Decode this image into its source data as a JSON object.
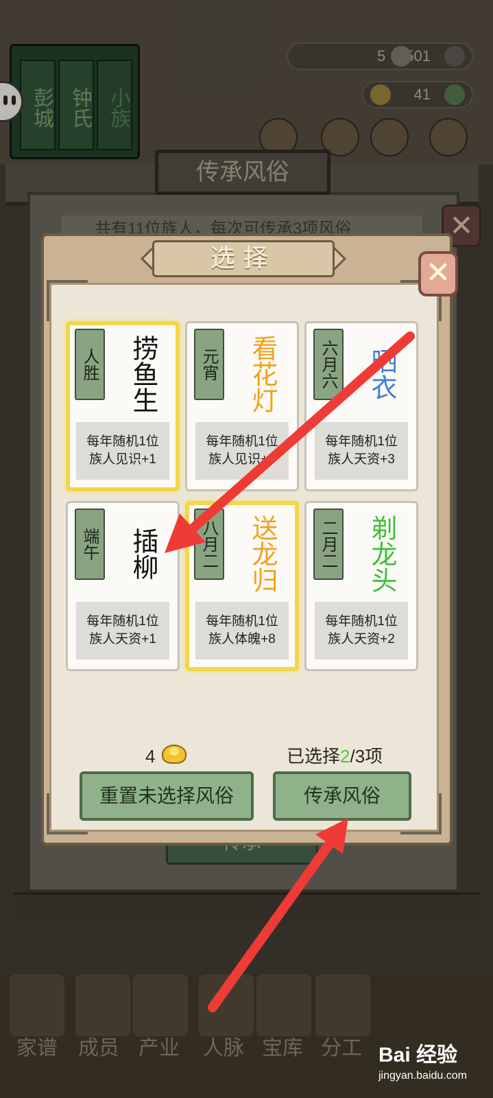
{
  "background": {
    "clan_names": [
      "彭城",
      "钟氏",
      "小族"
    ],
    "resources": [
      {
        "name": "tickets",
        "value": "5"
      },
      {
        "name": "coins",
        "value": "501"
      },
      {
        "name": "gold",
        "value": "41"
      }
    ],
    "panel_title": "传承风俗",
    "panel_text": "共有11位族人，每次可传承3项风俗",
    "panel_button": "传承",
    "nav": [
      "家谱",
      "成员",
      "产业",
      "人脉",
      "宝库",
      "分工"
    ]
  },
  "dialog": {
    "title": "选择",
    "close_icon": "close-icon",
    "cards": [
      {
        "festival": "人胜",
        "custom": "捞鱼生",
        "desc_line1": "每年随机1位",
        "desc_line2": "族人见识+1",
        "selected": true,
        "color": "#111111"
      },
      {
        "festival": "元宵",
        "custom": "看花灯",
        "desc_line1": "每年随机1位",
        "desc_line2": "族人见识+8",
        "selected": false,
        "color": "#f0a21c"
      },
      {
        "festival": "六月六",
        "custom": "晒衣",
        "desc_line1": "每年随机1位",
        "desc_line2": "族人天资+3",
        "selected": false,
        "color": "#3f7fd6"
      },
      {
        "festival": "端午",
        "custom": "插柳",
        "desc_line1": "每年随机1位",
        "desc_line2": "族人天资+1",
        "selected": false,
        "color": "#111111"
      },
      {
        "festival": "八月二",
        "custom": "送龙归",
        "desc_line1": "每年随机1位",
        "desc_line2": "族人体魄+8",
        "selected": true,
        "color": "#f0a21c"
      },
      {
        "festival": "二月二",
        "custom": "剃龙头",
        "desc_line1": "每年随机1位",
        "desc_line2": "族人天资+2",
        "selected": false,
        "color": "#3fbf3a"
      }
    ],
    "cost": "4",
    "selected_prefix": "已选择",
    "selected_count": "2",
    "selected_suffix": "/3项",
    "reset_button": "重置未选择风俗",
    "inherit_button": "传承风俗"
  },
  "watermark": {
    "brand": "Bai 经验",
    "url": "jingyan.baidu.com"
  },
  "colors": {
    "arrow": "#ef3b36",
    "selected_border": "#f3d64a",
    "count_accent": "#52c43f"
  }
}
